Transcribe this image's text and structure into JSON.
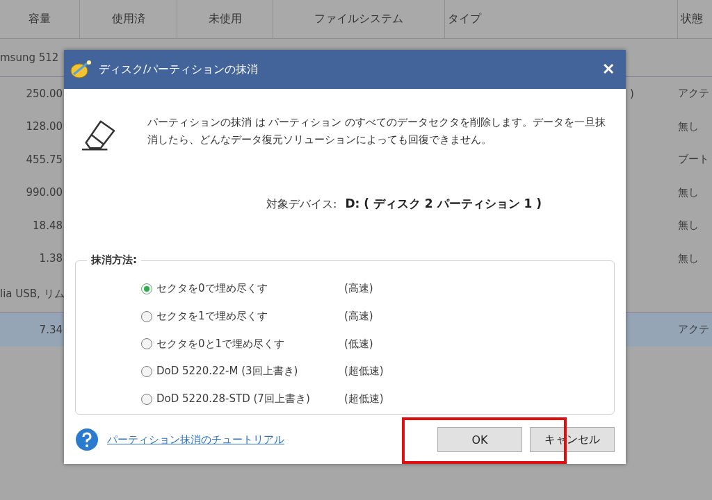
{
  "table": {
    "columns": [
      "容量",
      "使用済",
      "未使用",
      "ファイルシステム",
      "タイプ",
      "状態"
    ],
    "rows": [
      {
        "kind": "disk",
        "label": "msung 512"
      },
      {
        "kind": "partition",
        "capacity": "250.00",
        "type": ")",
        "status": "アクテ",
        "selected": false
      },
      {
        "kind": "partition",
        "capacity": "128.00",
        "status": "無し",
        "selected": false
      },
      {
        "kind": "partition",
        "capacity": "455.75",
        "status": "ブート",
        "selected": false
      },
      {
        "kind": "partition",
        "capacity": "990.00",
        "status": "無し",
        "selected": false
      },
      {
        "kind": "partition",
        "capacity": "18.48",
        "status": "無し",
        "selected": false
      },
      {
        "kind": "partition",
        "capacity": "1.38",
        "status": "無し",
        "selected": false
      },
      {
        "kind": "disk",
        "label": "lia USB, リム"
      },
      {
        "kind": "partition",
        "capacity": "7.34",
        "status": "アクテ",
        "selected": true
      }
    ]
  },
  "dialog": {
    "title": "ディスク/パーティションの抹消",
    "close": "✕",
    "description": "パーティションの抹消 は パーティション のすべてのデータセクタを削除します。データを一旦抹消したら、どんなデータ復元ソリューションによっても回復できません。",
    "target_label": "対象デバイス:",
    "target_value": "D: ( ディスク 2 パーティション 1 )",
    "method_title": "抹消方法:",
    "methods": [
      {
        "label": "セクタを0で埋め尽くす",
        "speed": "(高速)",
        "selected": true
      },
      {
        "label": "セクタを1で埋め尽くす",
        "speed": "(高速)",
        "selected": false
      },
      {
        "label": "セクタを0と1で埋め尽くす",
        "speed": "(低速)",
        "selected": false
      },
      {
        "label": "DoD 5220.22-M (3回上書き)",
        "speed": "(超低速)",
        "selected": false
      },
      {
        "label": "DoD 5220.28-STD (7回上書き)",
        "speed": "(超低速)",
        "selected": false
      }
    ],
    "help_link": "パーティション抹消のチュートリアル",
    "buttons": [
      "OK",
      "キャンセル"
    ]
  }
}
